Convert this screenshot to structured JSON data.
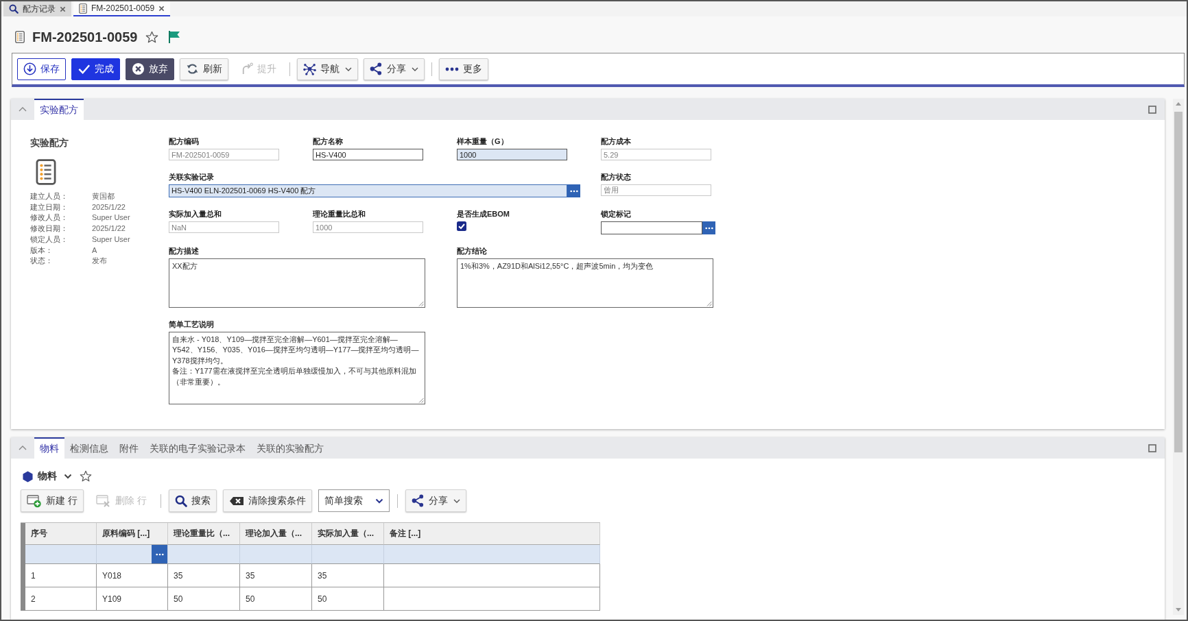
{
  "window_tabs": [
    {
      "kind": "search",
      "label": "配方记录",
      "selected": false
    },
    {
      "kind": "record",
      "label": "FM-202501-0059",
      "selected": true
    }
  ],
  "header": {
    "title": "FM-202501-0059",
    "favorite": false,
    "flagged": true
  },
  "toolbar": [
    {
      "kind": "button",
      "label": "保存",
      "disabled": false,
      "dropdown": false
    },
    {
      "kind": "button",
      "label": "完成",
      "disabled": false,
      "dropdown": false
    },
    {
      "kind": "button",
      "label": "放弃",
      "disabled": false,
      "dropdown": false
    },
    {
      "kind": "button",
      "label": "刷新",
      "disabled": false,
      "dropdown": false
    },
    {
      "kind": "button",
      "label": "提升",
      "disabled": true,
      "dropdown": false
    },
    {
      "kind": "separator"
    },
    {
      "kind": "button",
      "label": "导航",
      "disabled": false,
      "dropdown": true
    },
    {
      "kind": "button",
      "label": "分享",
      "disabled": false,
      "dropdown": true
    },
    {
      "kind": "separator"
    },
    {
      "kind": "button",
      "label": "更多",
      "disabled": false,
      "dropdown": false
    }
  ],
  "record_panel": {
    "tabs": [
      {
        "label": "实验配方",
        "selected": true
      }
    ],
    "heading": "实验配方",
    "meta": [
      {
        "label": "建立人员：",
        "value": "黄国都"
      },
      {
        "label": "建立日期：",
        "value": "2025/1/22"
      },
      {
        "label": "修改人员：",
        "value": "Super User"
      },
      {
        "label": "修改日期：",
        "value": "2025/1/22"
      },
      {
        "label": "锁定人员：",
        "value": "Super User"
      },
      {
        "label": "版本：",
        "value": "A"
      },
      {
        "label": "状态：",
        "value": "发布"
      }
    ],
    "form_rows": [
      [
        {
          "kind": "text",
          "label": "配方编码",
          "value": "FM-202501-0059",
          "readonly": true,
          "highlighted": false
        },
        {
          "kind": "text",
          "label": "配方名称",
          "value": "HS-V400",
          "readonly": false,
          "highlighted": false
        },
        {
          "kind": "text",
          "label": "样本重量（G）",
          "value": "1000",
          "readonly": false,
          "highlighted": true
        },
        {
          "kind": "text",
          "label": "配方成本",
          "value": "5.29",
          "readonly": true,
          "highlighted": false
        }
      ],
      [
        {
          "kind": "lookup",
          "label": "关联实验记录",
          "value": "HS-V400 ELN-202501-0069 HS-V400 配方",
          "readonly": false,
          "highlighted": true
        },
        {
          "kind": "text",
          "label": "配方状态",
          "value": "曾用",
          "readonly": true,
          "highlighted": false
        }
      ],
      [
        {
          "kind": "text",
          "label": "实际加入量总和",
          "value": "NaN",
          "readonly": true,
          "highlighted": false
        },
        {
          "kind": "text",
          "label": "理论重量比总和",
          "value": "1000",
          "readonly": true,
          "highlighted": false
        },
        {
          "kind": "checkbox",
          "label": "是否生成EBOM",
          "checked": true
        },
        {
          "kind": "lookup",
          "label": "锁定标记",
          "readonly": false,
          "highlighted": false
        }
      ],
      [
        {
          "kind": "textarea",
          "label": "配方描述",
          "paragraphs": [
            "XX配方"
          ]
        },
        {
          "kind": "textarea",
          "label": "配方结论",
          "paragraphs": [
            "1%和3%，AZ91D和AlSi12,55°C，超声波5min，均为变色"
          ]
        }
      ],
      [
        {
          "kind": "textarea",
          "label": "简单工艺说明",
          "paragraphs": [
            "自来水 - Y018、Y109—搅拌至完全溶解—Y601—搅拌至完全溶解—Y542、Y156、Y035、Y016—搅拌至均匀透明—Y177—搅拌至均匀透明—Y378搅拌均匀。",
            "备注：Y177需在液搅拌至完全透明后单独缓慢加入，不可与其他原料混加（非常重要）。"
          ]
        }
      ]
    ]
  },
  "detail_panel": {
    "tabs": [
      {
        "label": "物料",
        "selected": true
      },
      {
        "label": "检测信息",
        "selected": false
      },
      {
        "label": "附件",
        "selected": false
      },
      {
        "label": "关联的电子实验记录本",
        "selected": false
      },
      {
        "label": "关联的实验配方",
        "selected": false
      }
    ],
    "list_header": {
      "title": "物料",
      "favorite": false
    },
    "toolbar": [
      {
        "kind": "button",
        "label": "新建 行",
        "disabled": false,
        "dropdown": false
      },
      {
        "kind": "button",
        "label": "删除 行",
        "disabled": true,
        "dropdown": false
      },
      {
        "kind": "separator"
      },
      {
        "kind": "button",
        "label": "搜索",
        "disabled": false,
        "dropdown": false
      },
      {
        "kind": "button",
        "label": "清除搜索条件",
        "disabled": false,
        "dropdown": false
      },
      {
        "kind": "select",
        "value": "简单搜索"
      },
      {
        "kind": "separator"
      },
      {
        "kind": "button",
        "label": "分享",
        "disabled": false,
        "dropdown": true
      }
    ],
    "table": {
      "columns": [
        {
          "label": "序号",
          "lookup_filter": false
        },
        {
          "label": "原料编码 [...]",
          "lookup_filter": true
        },
        {
          "label": "理论重量比（...",
          "lookup_filter": false
        },
        {
          "label": "理论加入量（...",
          "lookup_filter": false
        },
        {
          "label": "实际加入量（...",
          "lookup_filter": false
        },
        {
          "label": "备注 [...]",
          "lookup_filter": false
        }
      ],
      "rows": [
        [
          "1",
          "Y018",
          "35",
          "35",
          "35"
        ],
        [
          "2",
          "Y109",
          "50",
          "50",
          "50"
        ]
      ]
    }
  }
}
